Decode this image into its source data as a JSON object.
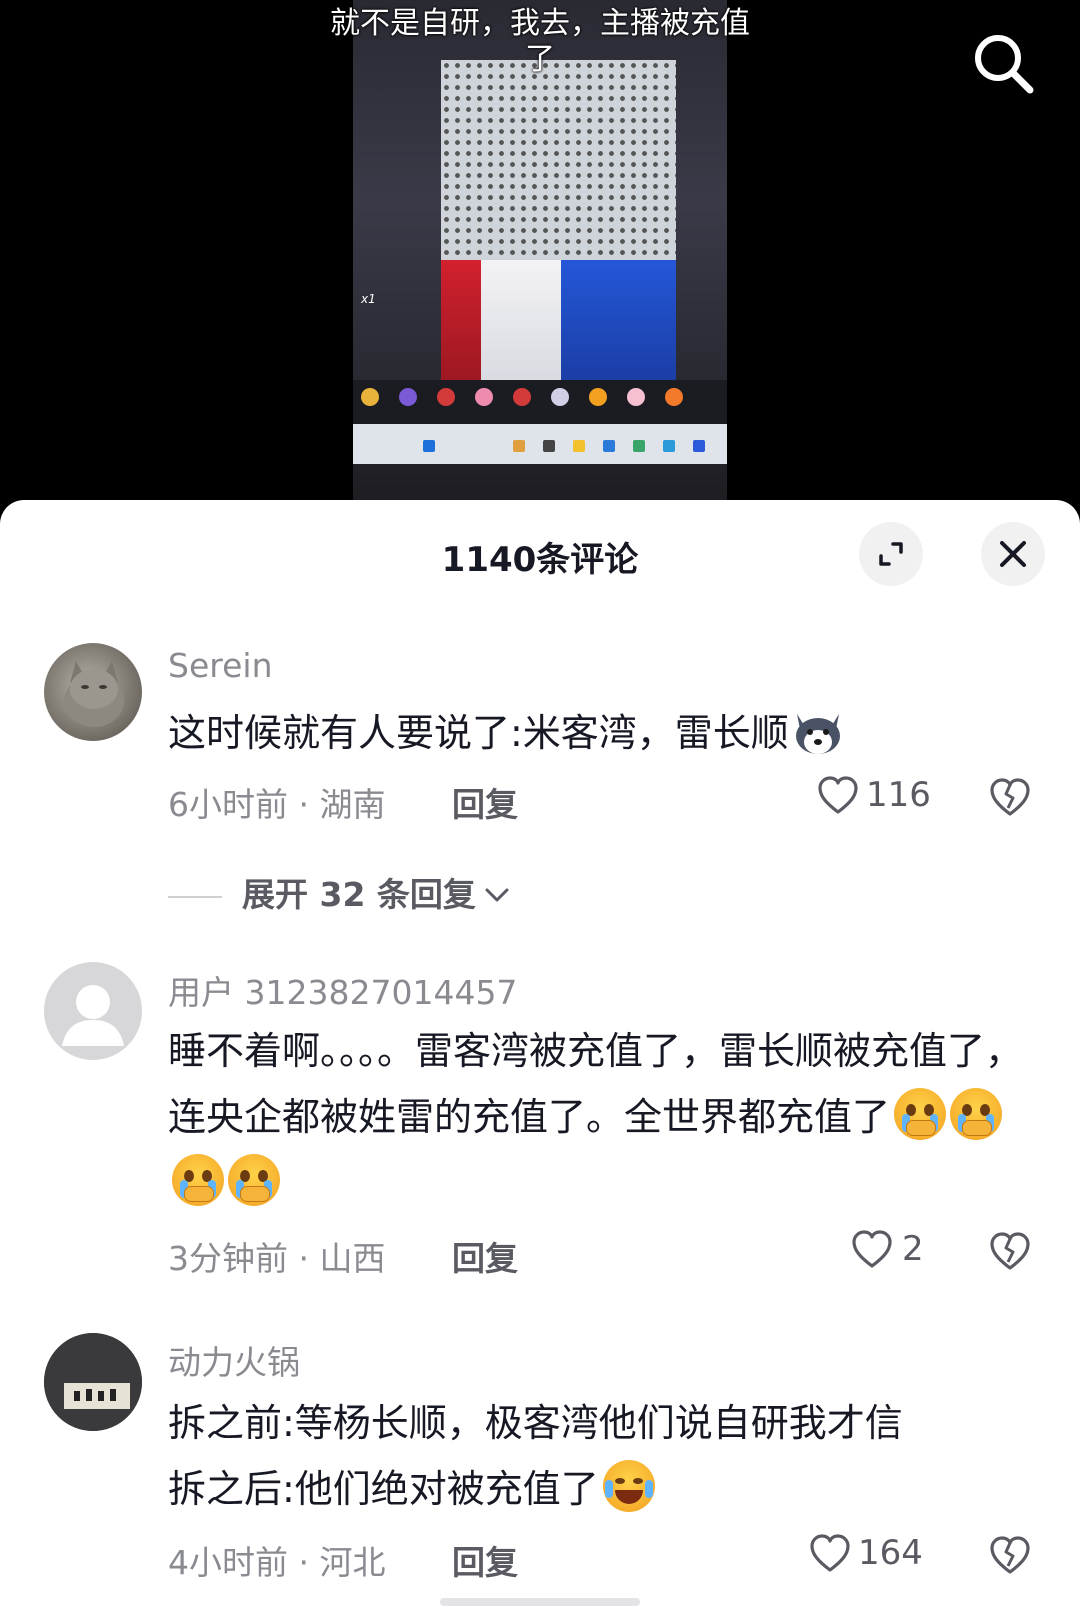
{
  "video": {
    "caption": "就不是自研，我去，主播被充值了",
    "multiplier": "x1"
  },
  "comments_sheet": {
    "title": "1140条评论"
  },
  "comments": [
    {
      "username": "Serein",
      "text": "这时候就有人要说了:米客湾，雷长顺",
      "time_location": "6小时前 · 湖南",
      "reply_label": "回复",
      "likes": "116",
      "expand_label": "展开 32 条回复"
    },
    {
      "username": "用户 3123827014457",
      "text": "睡不着啊。。。。雷客湾被充值了，雷长顺被充值了，连央企都被姓雷的充值了。全世界都充值了",
      "time_location": "3分钟前 · 山西",
      "reply_label": "回复",
      "likes": "2"
    },
    {
      "username": "动力火锅",
      "text_line1": "拆之前:等杨长顺，极客湾他们说自研我才信",
      "text_line2": "拆之后:他们绝对被充值了",
      "time_location": "4小时前 · 河北",
      "reply_label": "回复",
      "likes": "164"
    }
  ],
  "colors": {
    "sheet_bg": "#ffffff",
    "primary_text": "#161823",
    "secondary_text": "#8a8b91",
    "video_bg": "#000000"
  }
}
